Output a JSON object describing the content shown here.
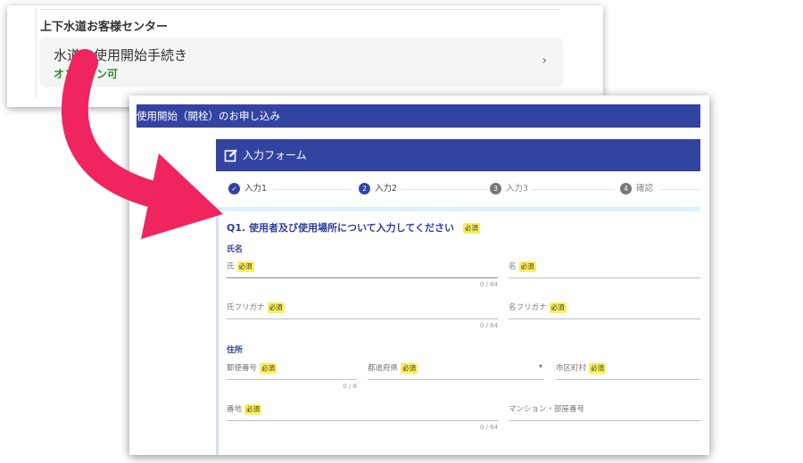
{
  "customer_center": {
    "title": "上下水道お客様センター",
    "service": {
      "name": "水道の使用開始手続き",
      "status": "オンライン可",
      "chevron": "›"
    }
  },
  "form_window": {
    "page_title": "使用開始（開栓）のお申し込み",
    "form_title": "入力フォーム",
    "steps": [
      {
        "icon": "check-icon",
        "label": "入力1",
        "number": "✓",
        "state": "done"
      },
      {
        "icon": "step-2-icon",
        "label": "入力2",
        "number": "2",
        "state": "current"
      },
      {
        "icon": "step-3-icon",
        "label": "入力3",
        "number": "3",
        "state": "pending"
      },
      {
        "icon": "step-4-icon",
        "label": "確認",
        "number": "4",
        "state": "pending"
      }
    ],
    "question": "Q1. 使用者及び使用場所について入力してください",
    "required_tag": "必須",
    "sections": {
      "name": "氏名",
      "address": "住所"
    },
    "fields": {
      "last_name": {
        "label": "氏",
        "counter": "0 / 64"
      },
      "first_name": {
        "label": "名"
      },
      "last_name_kana": {
        "label": "氏フリガナ",
        "counter": "0 / 64"
      },
      "first_name_kana": {
        "label": "名フリガナ"
      },
      "postal_code": {
        "label": "郵便番号",
        "counter": "0 / 8"
      },
      "prefecture": {
        "label": "都道府県",
        "caret": "▾"
      },
      "city": {
        "label": "市区町村"
      },
      "street_number": {
        "label": "番地",
        "counter": "0 / 64"
      },
      "building": {
        "label": "マンション・部屋番号"
      }
    }
  },
  "colors": {
    "header_blue": "#3344a0",
    "question_blue": "#2c3f9c",
    "required_yellow": "#fbf05a",
    "status_green": "#2f8a2f",
    "arrow_pink": "#f0245f"
  }
}
